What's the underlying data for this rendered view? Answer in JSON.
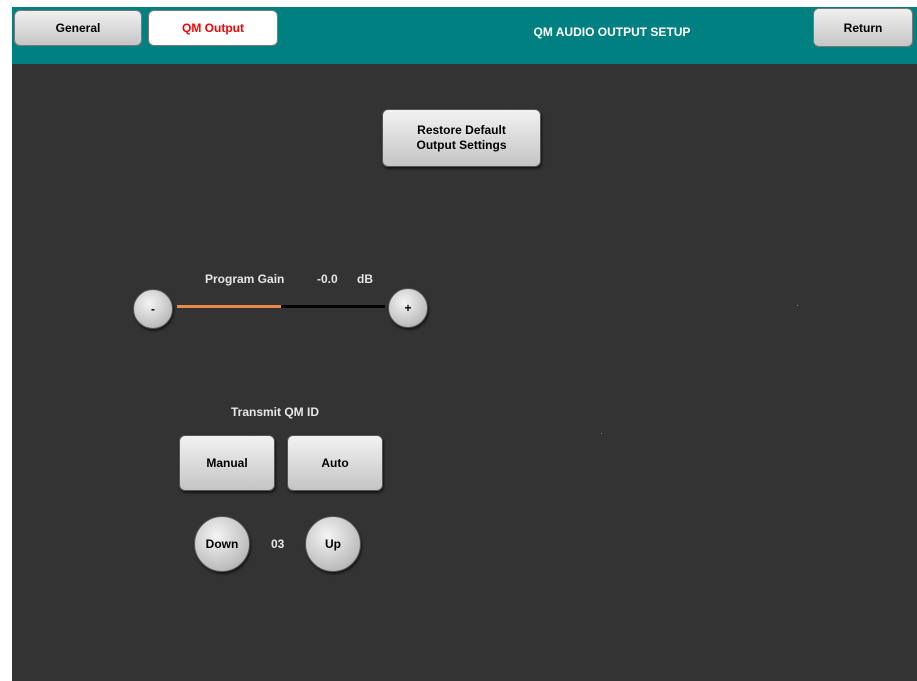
{
  "header": {
    "tabs": [
      {
        "label": "General"
      },
      {
        "label": "QM Output"
      }
    ],
    "title": "QM AUDIO OUTPUT SETUP",
    "return_label": "Return"
  },
  "restore_button": {
    "label": "Restore Default Output Settings"
  },
  "program_gain": {
    "label": "Program Gain",
    "value": "-0.0",
    "unit": "dB",
    "minus_label": "-",
    "plus_label": "+",
    "fill_fraction": 0.5
  },
  "transmit": {
    "label": "Transmit QM ID",
    "manual_label": "Manual",
    "auto_label": "Auto",
    "down_label": "Down",
    "up_label": "Up",
    "id_value": "03"
  },
  "colors": {
    "background": "#333333",
    "header": "#008080",
    "active_tab_text": "#ff0000",
    "slider_fill": "#e8894a"
  }
}
